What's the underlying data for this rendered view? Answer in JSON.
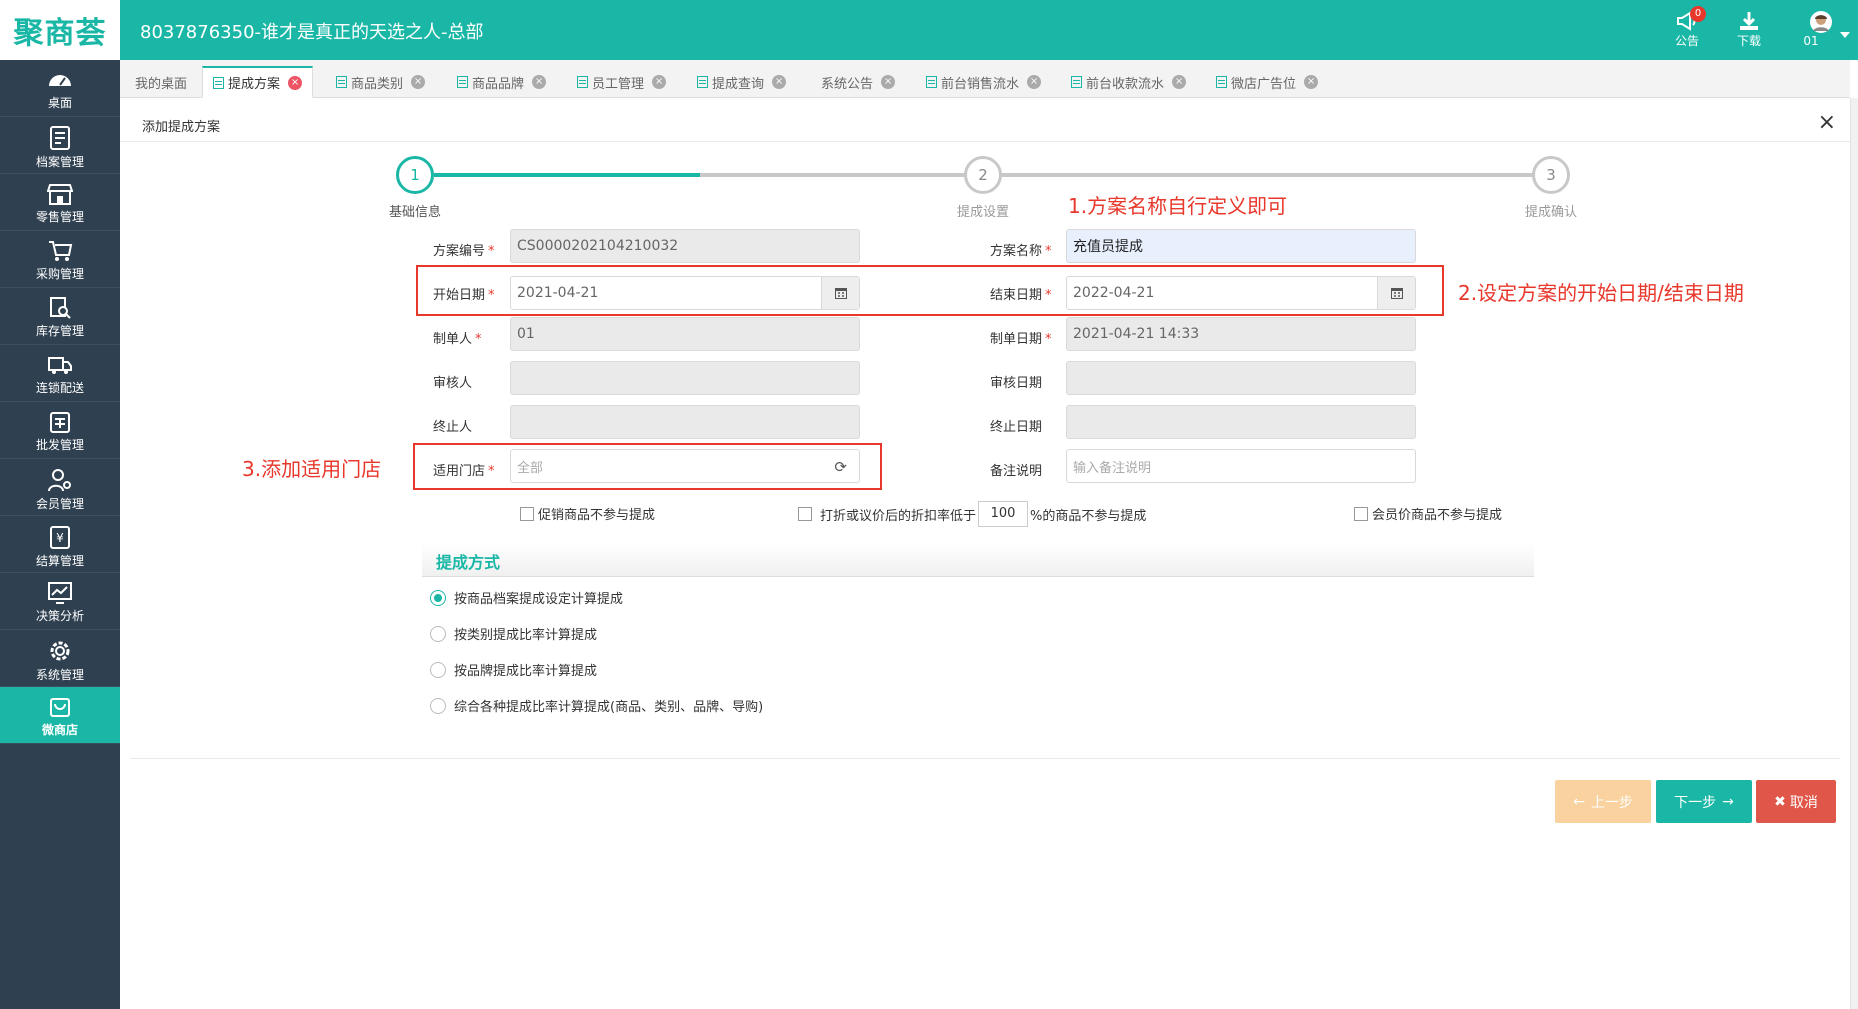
{
  "header": {
    "logo": "聚商荟",
    "title": "8037876350-谁才是真正的天选之人-总部",
    "notice_label": "公告",
    "notice_count": "0",
    "download_label": "下载",
    "user_label": "01"
  },
  "sidebar": {
    "items": [
      {
        "label": "桌面",
        "icon": "dashboard-icon"
      },
      {
        "label": "档案管理",
        "icon": "archive-icon"
      },
      {
        "label": "零售管理",
        "icon": "store-icon"
      },
      {
        "label": "采购管理",
        "icon": "cart-icon"
      },
      {
        "label": "库存管理",
        "icon": "inventory-search-icon"
      },
      {
        "label": "连锁配送",
        "icon": "truck-icon"
      },
      {
        "label": "批发管理",
        "icon": "wholesale-icon"
      },
      {
        "label": "会员管理",
        "icon": "member-icon"
      },
      {
        "label": "结算管理",
        "icon": "yen-icon"
      },
      {
        "label": "决策分析",
        "icon": "chart-icon"
      },
      {
        "label": "系统管理",
        "icon": "gear-icon"
      },
      {
        "label": "微商店",
        "icon": "shop-bag-icon"
      }
    ],
    "active_index": 11
  },
  "tabs": [
    {
      "label": "我的桌面"
    },
    {
      "label": "提成方案"
    },
    {
      "label": "商品类别"
    },
    {
      "label": "商品品牌"
    },
    {
      "label": "员工管理"
    },
    {
      "label": "提成查询"
    },
    {
      "label": "系统公告"
    },
    {
      "label": "前台销售流水"
    },
    {
      "label": "前台收款流水"
    },
    {
      "label": "微店广告位"
    }
  ],
  "panel": {
    "title": "添加提成方案",
    "close": "×"
  },
  "steps": [
    {
      "num": "1",
      "label": "基础信息"
    },
    {
      "num": "2",
      "label": "提成设置"
    },
    {
      "num": "3",
      "label": "提成确认"
    }
  ],
  "form": {
    "scheme_no_label": "方案编号",
    "scheme_no_value": "CS0000202104210032",
    "scheme_name_label": "方案名称",
    "scheme_name_value": "充值员提成",
    "start_date_label": "开始日期",
    "start_date_value": "2021-04-21",
    "end_date_label": "结束日期",
    "end_date_value": "2022-04-21",
    "creator_label": "制单人",
    "creator_value": "01",
    "create_date_label": "制单日期",
    "create_date_value": "2021-04-21 14:33",
    "auditor_label": "审核人",
    "audit_date_label": "审核日期",
    "terminator_label": "终止人",
    "terminate_date_label": "终止日期",
    "store_label": "适用门店",
    "store_value": "全部",
    "remark_label": "备注说明",
    "remark_placeholder": "输入备注说明",
    "required_mark": "*"
  },
  "options": {
    "promo_excluded": "促销商品不参与提成",
    "discount_prefix": "打折或议价后的折扣率低于",
    "discount_value": "100",
    "discount_suffix": "%的商品不参与提成",
    "member_price_excluded": "会员价商品不参与提成"
  },
  "commission": {
    "section_title": "提成方式",
    "methods": [
      "按商品档案提成设定计算提成",
      "按类别提成比率计算提成",
      "按品牌提成比率计算提成",
      "综合各种提成比率计算提成(商品、类别、品牌、导购)"
    ],
    "selected_index": 0
  },
  "buttons": {
    "prev": "上一步",
    "next": "下一步",
    "cancel": "取消"
  },
  "annotations": {
    "a1": "1.方案名称自行定义即可",
    "a2": "2.设定方案的开始日期/结束日期",
    "a3": "3.添加适用门店"
  },
  "colors": {
    "primary": "#1ab7a6",
    "sidebar": "#2f4050",
    "annotation": "#e8382c",
    "cancel": "#e0574a",
    "prev_disabled": "#f9d29f"
  }
}
